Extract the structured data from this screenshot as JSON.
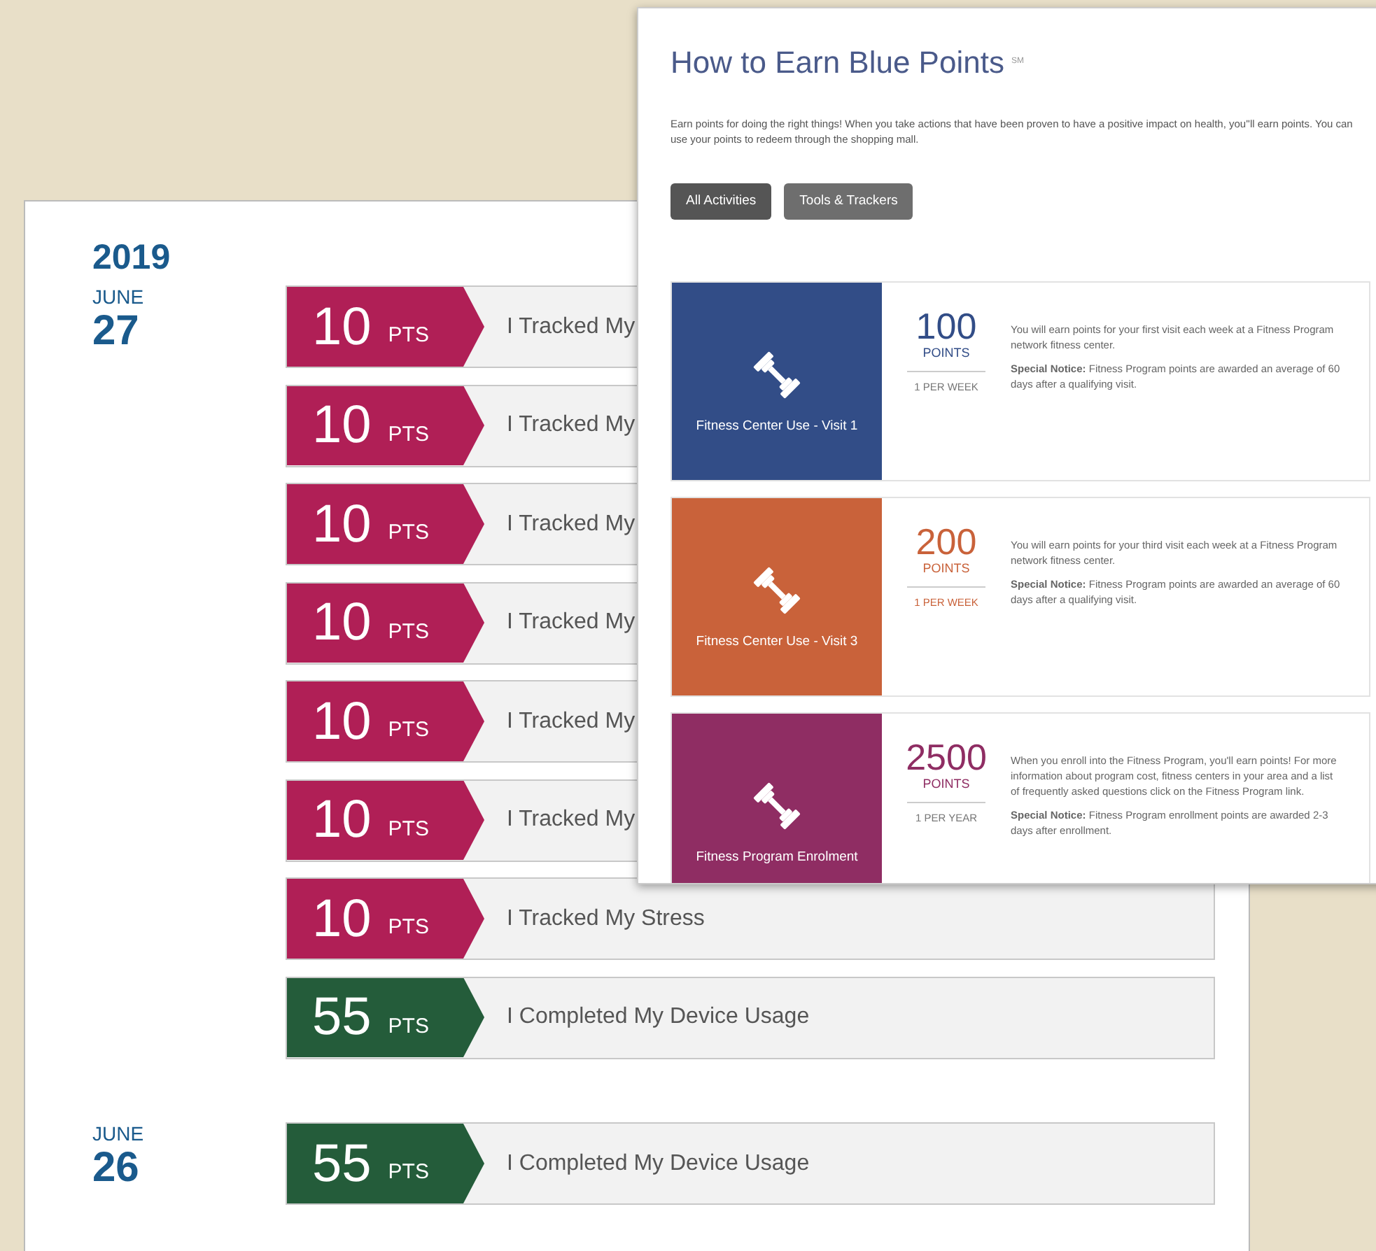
{
  "activity_log": {
    "year": "2019",
    "days": [
      {
        "month": "JUNE",
        "day": "27",
        "entries": [
          {
            "points": "10",
            "unit": "PTS",
            "activity": "I Tracked My",
            "color": "#b01f56"
          },
          {
            "points": "10",
            "unit": "PTS",
            "activity": "I Tracked My",
            "color": "#b01f56"
          },
          {
            "points": "10",
            "unit": "PTS",
            "activity": "I Tracked My",
            "color": "#b01f56"
          },
          {
            "points": "10",
            "unit": "PTS",
            "activity": "I Tracked My",
            "color": "#b01f56"
          },
          {
            "points": "10",
            "unit": "PTS",
            "activity": "I Tracked My",
            "color": "#b01f56"
          },
          {
            "points": "10",
            "unit": "PTS",
            "activity": "I Tracked My",
            "color": "#b01f56"
          },
          {
            "points": "10",
            "unit": "PTS",
            "activity": "I Tracked My Stress",
            "color": "#b01f56"
          },
          {
            "points": "55",
            "unit": "PTS",
            "activity": "I Completed My Device Usage",
            "color": "#245c3a"
          }
        ]
      },
      {
        "month": "JUNE",
        "day": "26",
        "entries": [
          {
            "points": "55",
            "unit": "PTS",
            "activity": "I Completed My Device Usage",
            "color": "#245c3a"
          }
        ]
      }
    ]
  },
  "earn_page": {
    "title": "How to Earn Blue Points",
    "title_mark": "SM",
    "intro": "Earn points for doing the right things! When you take actions that have been proven to have a positive impact on health, you''ll earn points. You can use your points to redeem through the shopping mall.",
    "tabs": [
      {
        "label": "All Activities",
        "selected": true
      },
      {
        "label": "Tools & Trackers",
        "selected": false
      }
    ],
    "cards": [
      {
        "name": "Fitness Center Use - Visit 1",
        "points": "100",
        "unit": "POINTS",
        "frequency": "1 PER WEEK",
        "color": "#324d87",
        "paragraphs": [
          "You will earn points for your first visit each week at a Fitness Program network fitness center.",
          "**Special Notice:** Fitness Program points are awarded an average of 60 days after a qualifying visit."
        ]
      },
      {
        "name": "Fitness Center Use - Visit 3",
        "points": "200",
        "unit": "POINTS",
        "frequency": "1 PER WEEK",
        "color": "#c9623a",
        "paragraphs": [
          "You will earn points for your third visit each week at a Fitness Program network fitness center.",
          "**Special Notice:** Fitness Program points are awarded an average of 60 days after a qualifying visit."
        ]
      },
      {
        "name": "Fitness Program Enrolment",
        "points": "2500",
        "unit": "POINTS",
        "frequency": "1 PER YEAR",
        "color": "#8f2d63",
        "paragraphs": [
          "When you enroll into the Fitness Program, you'll earn points! For more information about program cost, fitness centers in your area and a list of frequently asked questions click on the Fitness Program link.",
          "**Special Notice:** Fitness Program enrollment points are awarded 2-3 days after enrollment."
        ]
      }
    ]
  }
}
